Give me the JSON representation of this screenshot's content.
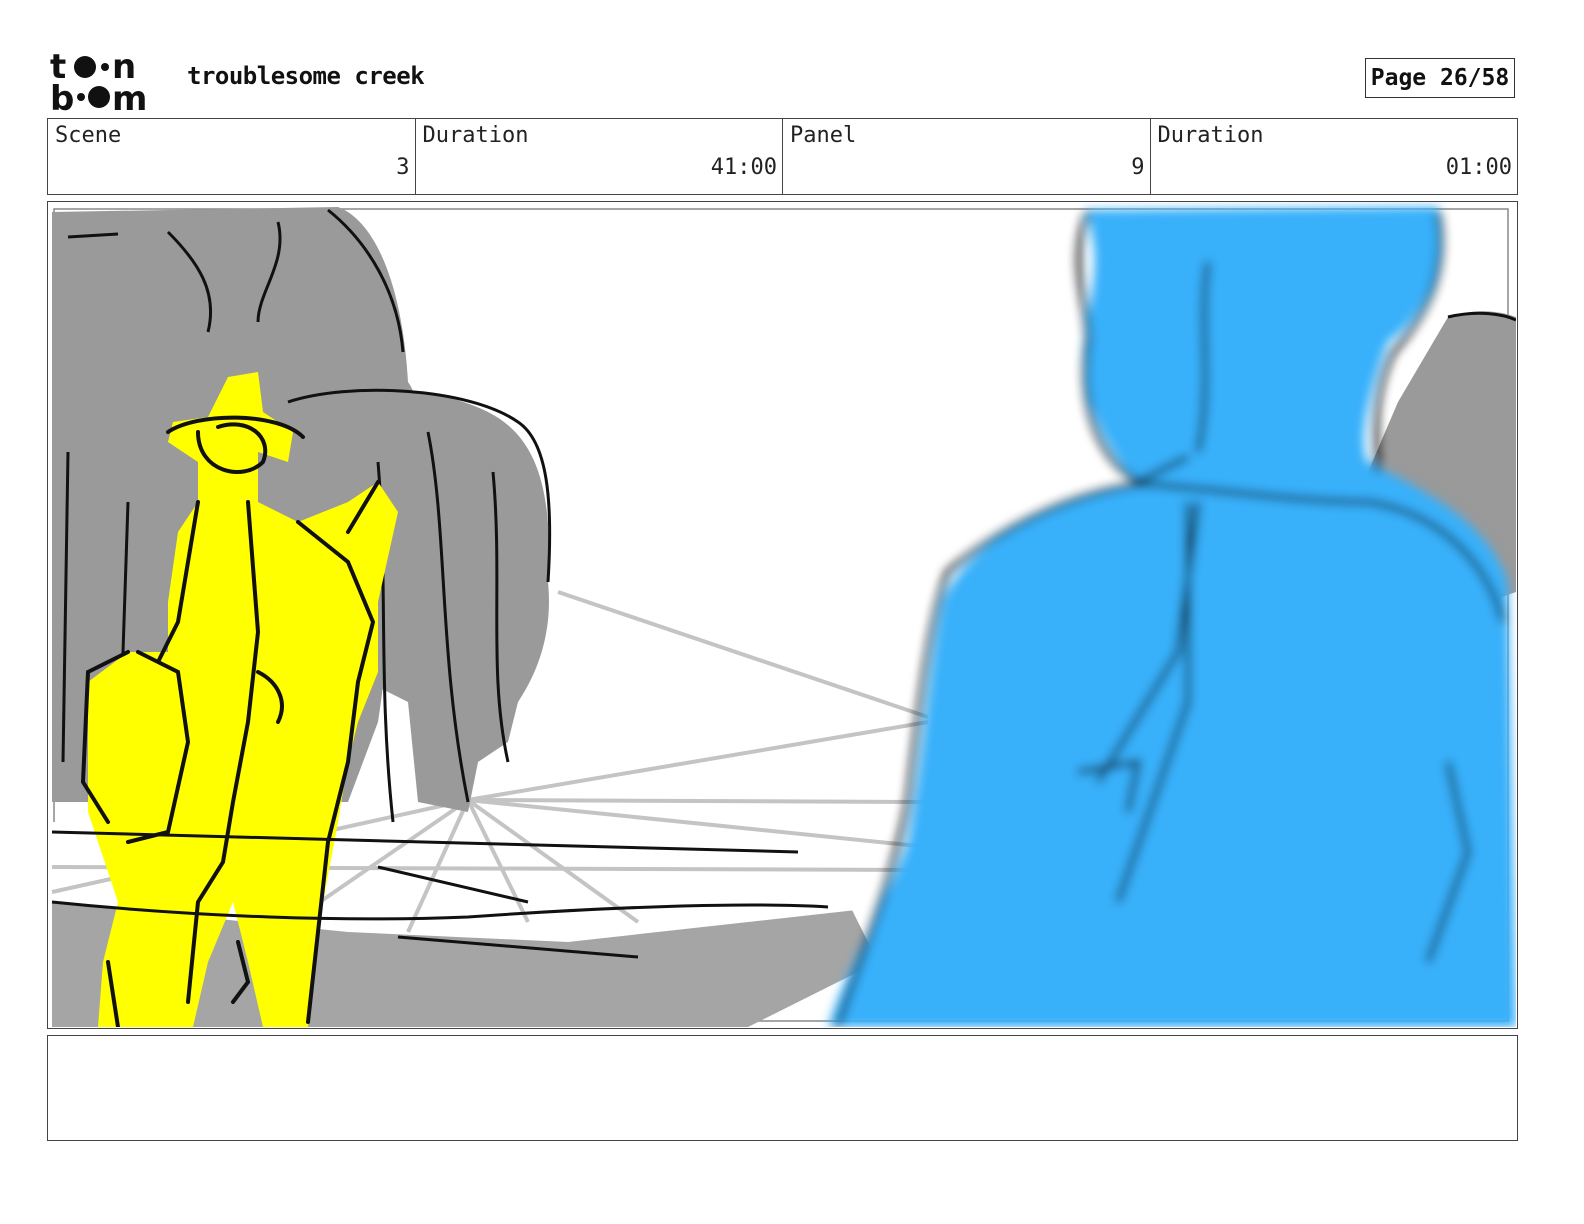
{
  "header": {
    "logo_text": "toon boom",
    "project_title": "troublesome creek",
    "page_label": "Page 26/58"
  },
  "info": {
    "scene_label": "Scene",
    "scene_value": "3",
    "scene_duration_label": "Duration",
    "scene_duration_value": "41:00",
    "panel_label": "Panel",
    "panel_value": "9",
    "panel_duration_label": "Duration",
    "panel_duration_value": "01:00"
  },
  "panel": {
    "colors": {
      "rider": "#ffff00",
      "foreground_figure": "#38b0fa",
      "trees": "#9a9a9a",
      "ground": "#a8a8a8"
    }
  },
  "notes": {
    "text": ""
  }
}
